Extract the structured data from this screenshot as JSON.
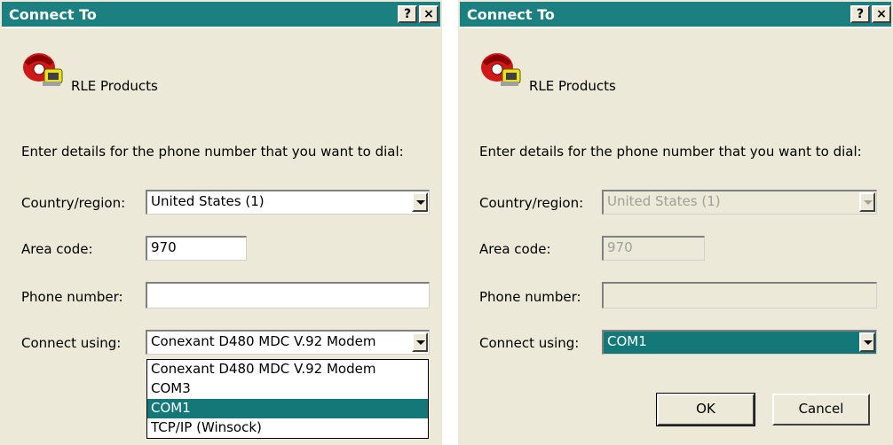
{
  "left": {
    "title": "Connect To",
    "help_label": "?",
    "close_label": "×",
    "heading": "RLE Products",
    "prompt": "Enter details for the phone number that you want to dial:",
    "country_label": "Country/region:",
    "country_value": "United States (1)",
    "area_label": "Area code:",
    "area_value": "970",
    "phone_label": "Phone number:",
    "phone_value": "",
    "connect_label": "Connect using:",
    "connect_value": "Conexant D480 MDC V.92 Modem",
    "dropdown_options": [
      "Conexant D480 MDC V.92 Modem",
      "COM3",
      "COM1",
      "TCP/IP (Winsock)"
    ],
    "dropdown_highlighted": "COM1"
  },
  "right": {
    "title": "Connect To",
    "help_label": "?",
    "close_label": "×",
    "heading": "RLE Products",
    "prompt": "Enter details for the phone number that you want to dial:",
    "country_label": "Country/region:",
    "country_value": "United States (1)",
    "area_label": "Area code:",
    "area_value": "970",
    "phone_label": "Phone number:",
    "phone_value": "",
    "connect_label": "Connect using:",
    "connect_value": "COM1",
    "ok_label": "OK",
    "cancel_label": "Cancel"
  },
  "colors": {
    "titlebar": "#1c8080",
    "selection": "#147878",
    "dialog_bg": "#ece9d8"
  },
  "icons": [
    "phone-icon",
    "help-icon",
    "close-icon",
    "dropdown-arrow-icon"
  ]
}
